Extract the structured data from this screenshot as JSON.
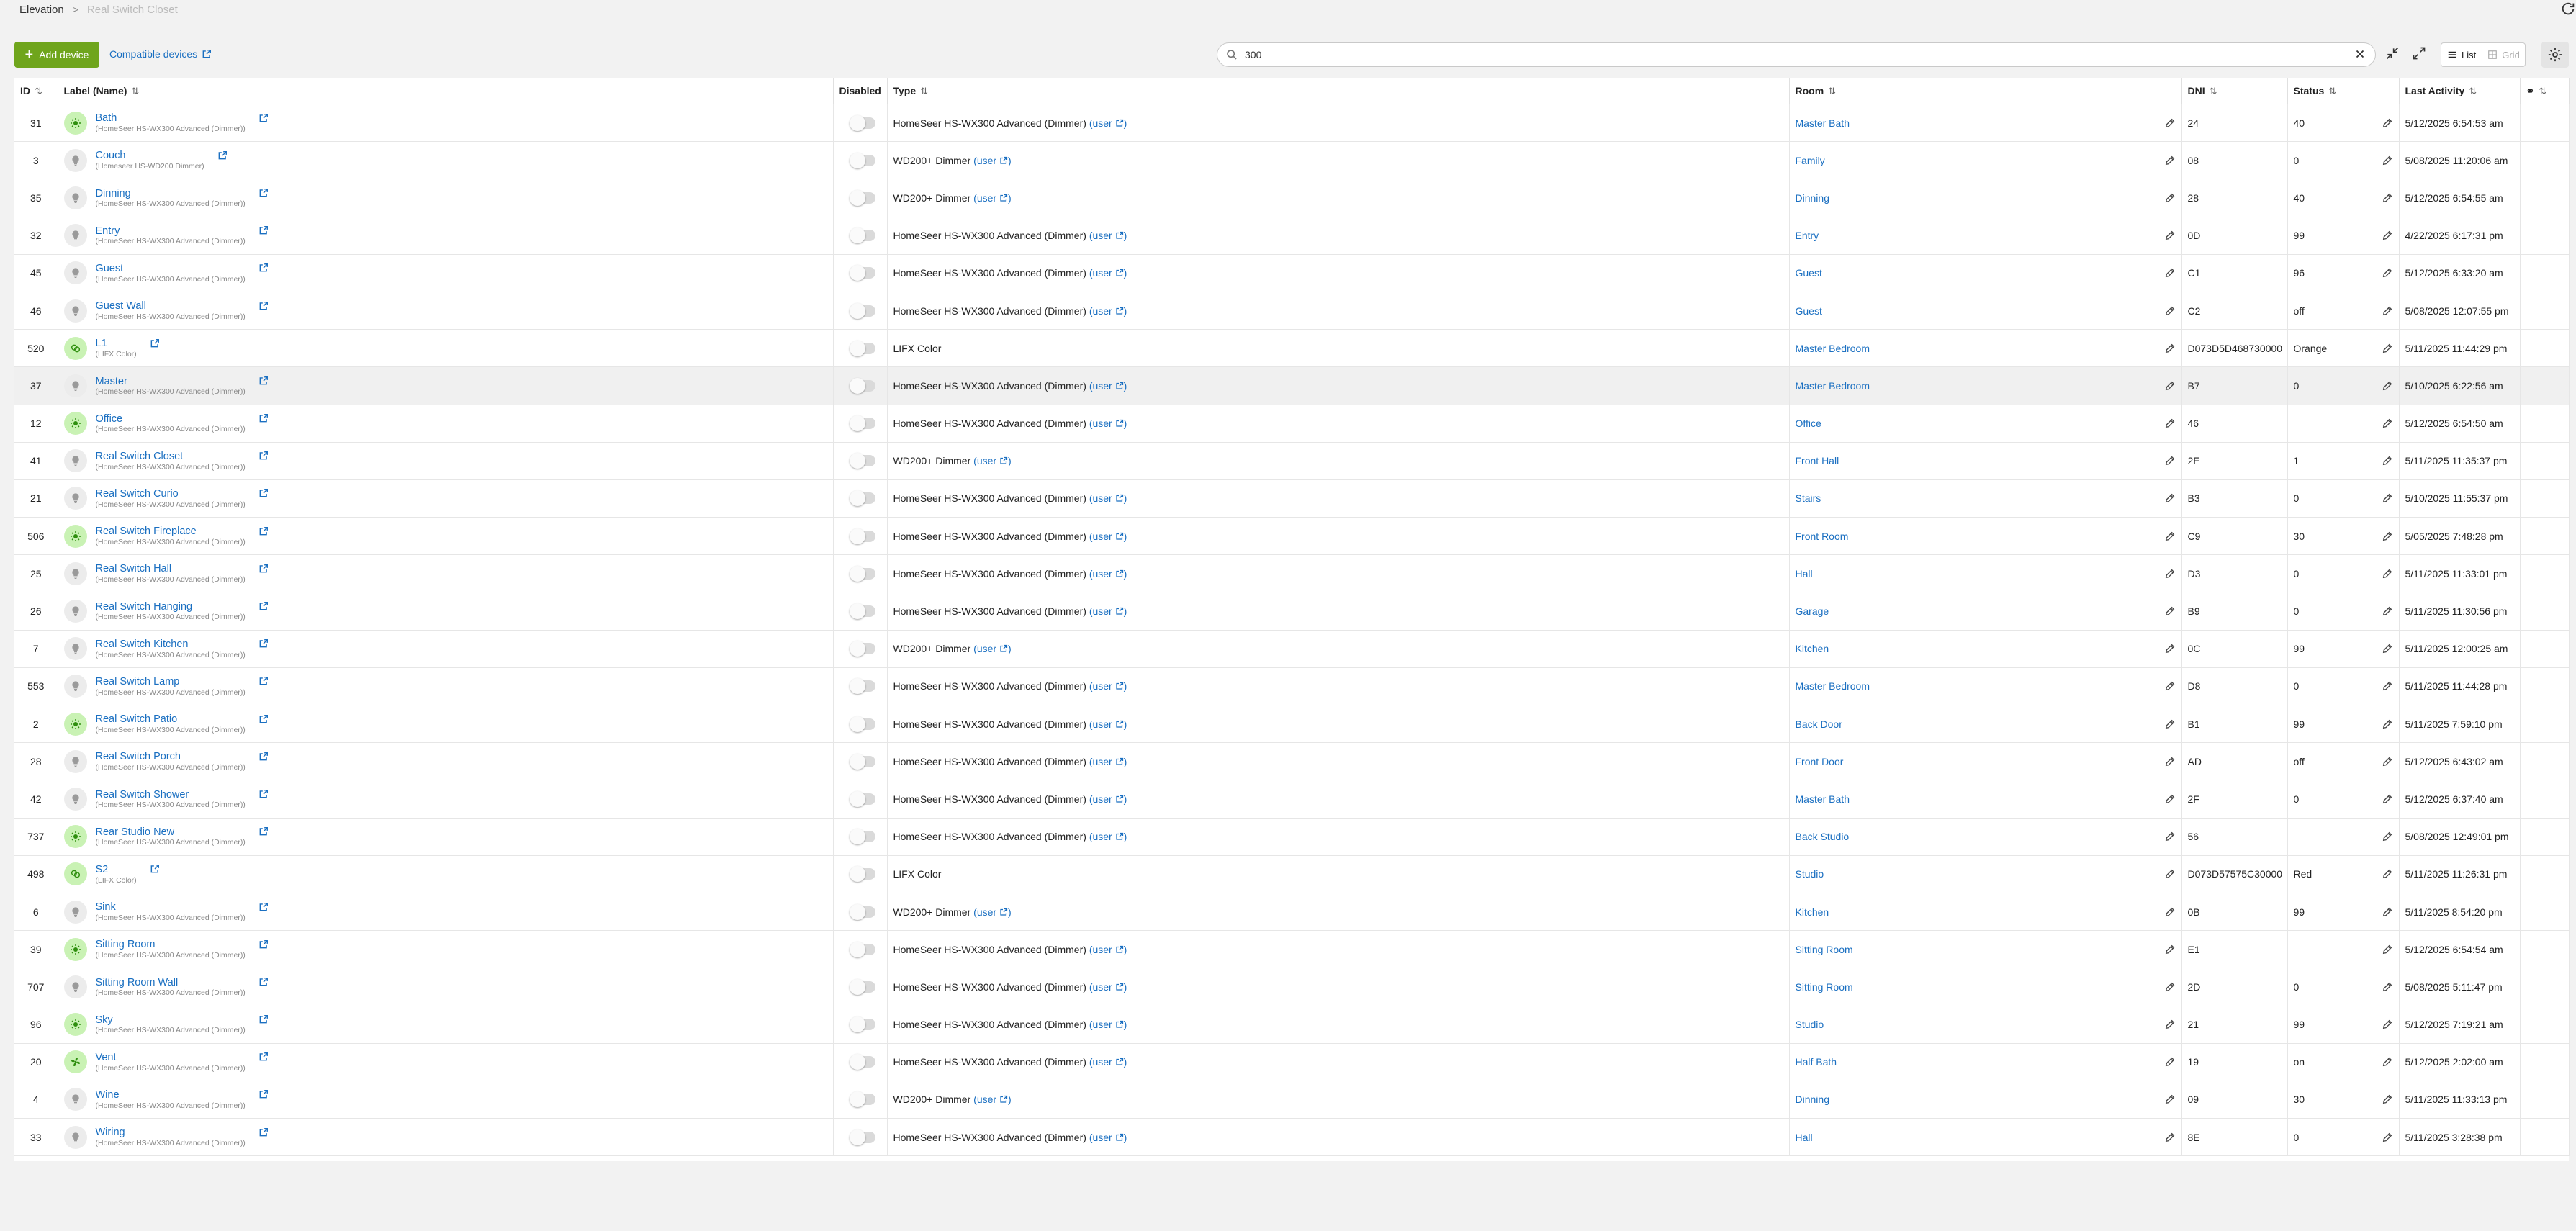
{
  "breadcrumb": {
    "root": "Elevation",
    "current": "Real Switch Closet"
  },
  "toolbar": {
    "add_label": "Add device",
    "compatible_label": "Compatible devices",
    "search_value": "300",
    "view_list": "List",
    "view_grid": "Grid"
  },
  "columns": {
    "id": "ID",
    "label": "Label (Name)",
    "disabled": "Disabled",
    "type": "Type",
    "room": "Room",
    "dni": "DNI",
    "status": "Status",
    "last_activity": "Last Activity"
  },
  "user_text": "user",
  "colors": {
    "accent": "#6fa51c",
    "link": "#1a6fc1",
    "bulb_on_bg": "#c9f2b4",
    "bulb_on_fg": "#2f8f0f"
  },
  "rows": [
    {
      "id": "31",
      "label": "Bath",
      "name": "(HomeSeer HS-WX300 Advanced (Dimmer))",
      "on": true,
      "icon": "sun-icon",
      "type": "HomeSeer HS-WX300 Advanced (Dimmer)",
      "room": "Master Bath",
      "dni": "24",
      "status": "40",
      "last": "5/12/2025 6:54:53 am"
    },
    {
      "id": "3",
      "label": "Couch",
      "name": "(Homeseer HS-WD200 Dimmer)",
      "on": false,
      "icon": "bulb-icon",
      "type": "WD200+ Dimmer",
      "room": "Family",
      "dni": "08",
      "status": "0",
      "last": "5/08/2025 11:20:06 am"
    },
    {
      "id": "35",
      "label": "Dinning",
      "name": "(HomeSeer HS-WX300 Advanced (Dimmer))",
      "on": false,
      "icon": "bulb-icon",
      "type": "WD200+ Dimmer",
      "room": "Dinning",
      "dni": "28",
      "status": "40",
      "last": "5/12/2025 6:54:55 am"
    },
    {
      "id": "32",
      "label": "Entry",
      "name": "(HomeSeer HS-WX300 Advanced (Dimmer))",
      "on": false,
      "icon": "bulb-icon",
      "type": "HomeSeer HS-WX300 Advanced (Dimmer)",
      "room": "Entry",
      "dni": "0D",
      "status": "99",
      "last": "4/22/2025 6:17:31 pm"
    },
    {
      "id": "45",
      "label": "Guest",
      "name": "(HomeSeer HS-WX300 Advanced (Dimmer))",
      "on": false,
      "icon": "bulb-icon",
      "type": "HomeSeer HS-WX300 Advanced (Dimmer)",
      "room": "Guest",
      "dni": "C1",
      "status": "96",
      "last": "5/12/2025 6:33:20 am"
    },
    {
      "id": "46",
      "label": "Guest Wall",
      "name": "(HomeSeer HS-WX300 Advanced (Dimmer))",
      "on": false,
      "icon": "bulb-icon",
      "type": "HomeSeer HS-WX300 Advanced (Dimmer)",
      "room": "Guest",
      "dni": "C2",
      "status": "off",
      "last": "5/08/2025 12:07:55 pm"
    },
    {
      "id": "520",
      "label": "L1",
      "name": "(LIFX Color)",
      "on": true,
      "icon": "color-bulb-icon",
      "type": "LIFX Color",
      "room": "Master Bedroom",
      "dni": "D073D5D468730000",
      "status": "Orange",
      "last": "5/11/2025 11:44:29 pm"
    },
    {
      "id": "37",
      "label": "Master",
      "name": "(HomeSeer HS-WX300 Advanced (Dimmer))",
      "on": false,
      "icon": "bulb-icon",
      "type": "HomeSeer HS-WX300 Advanced (Dimmer)",
      "room": "Master Bedroom",
      "dni": "B7",
      "status": "0",
      "last": "5/10/2025 6:22:56 am",
      "highlight": true
    },
    {
      "id": "12",
      "label": "Office",
      "name": "(HomeSeer HS-WX300 Advanced (Dimmer))",
      "on": true,
      "icon": "sun-icon",
      "type": "HomeSeer HS-WX300 Advanced (Dimmer)",
      "room": "Office",
      "dni": "46",
      "status": "",
      "last": "5/12/2025 6:54:50 am"
    },
    {
      "id": "41",
      "label": "Real Switch Closet",
      "name": "(HomeSeer HS-WX300 Advanced (Dimmer))",
      "on": false,
      "icon": "bulb-icon",
      "type": "WD200+ Dimmer",
      "room": "Front Hall",
      "dni": "2E",
      "status": "1",
      "last": "5/11/2025 11:35:37 pm"
    },
    {
      "id": "21",
      "label": "Real Switch Curio",
      "name": "(HomeSeer HS-WX300 Advanced (Dimmer))",
      "on": false,
      "icon": "bulb-icon",
      "type": "HomeSeer HS-WX300 Advanced (Dimmer)",
      "room": "Stairs",
      "dni": "B3",
      "status": "0",
      "last": "5/10/2025 11:55:37 pm"
    },
    {
      "id": "506",
      "label": "Real Switch Fireplace",
      "name": "(HomeSeer HS-WX300 Advanced (Dimmer))",
      "on": true,
      "icon": "sun-icon",
      "type": "HomeSeer HS-WX300 Advanced (Dimmer)",
      "room": "Front Room",
      "dni": "C9",
      "status": "30",
      "last": "5/05/2025 7:48:28 pm"
    },
    {
      "id": "25",
      "label": "Real Switch Hall",
      "name": "(HomeSeer HS-WX300 Advanced (Dimmer))",
      "on": false,
      "icon": "bulb-icon",
      "type": "HomeSeer HS-WX300 Advanced (Dimmer)",
      "room": "Hall",
      "dni": "D3",
      "status": "0",
      "last": "5/11/2025 11:33:01 pm"
    },
    {
      "id": "26",
      "label": "Real Switch Hanging",
      "name": "(HomeSeer HS-WX300 Advanced (Dimmer))",
      "on": false,
      "icon": "bulb-icon",
      "type": "HomeSeer HS-WX300 Advanced (Dimmer)",
      "room": "Garage",
      "dni": "B9",
      "status": "0",
      "last": "5/11/2025 11:30:56 pm"
    },
    {
      "id": "7",
      "label": "Real Switch Kitchen",
      "name": "(HomeSeer HS-WX300 Advanced (Dimmer))",
      "on": false,
      "icon": "bulb-icon",
      "type": "WD200+ Dimmer",
      "room": "Kitchen",
      "dni": "0C",
      "status": "99",
      "last": "5/11/2025 12:00:25 am"
    },
    {
      "id": "553",
      "label": "Real Switch Lamp",
      "name": "(HomeSeer HS-WX300 Advanced (Dimmer))",
      "on": false,
      "icon": "bulb-icon",
      "type": "HomeSeer HS-WX300 Advanced (Dimmer)",
      "room": "Master Bedroom",
      "dni": "D8",
      "status": "0",
      "last": "5/11/2025 11:44:28 pm"
    },
    {
      "id": "2",
      "label": "Real Switch Patio",
      "name": "(HomeSeer HS-WX300 Advanced (Dimmer))",
      "on": true,
      "icon": "sun-icon",
      "type": "HomeSeer HS-WX300 Advanced (Dimmer)",
      "room": "Back Door",
      "dni": "B1",
      "status": "99",
      "last": "5/11/2025 7:59:10 pm"
    },
    {
      "id": "28",
      "label": "Real Switch Porch",
      "name": "(HomeSeer HS-WX300 Advanced (Dimmer))",
      "on": false,
      "icon": "bulb-icon",
      "type": "HomeSeer HS-WX300 Advanced (Dimmer)",
      "room": "Front Door",
      "dni": "AD",
      "status": "off",
      "last": "5/12/2025 6:43:02 am"
    },
    {
      "id": "42",
      "label": "Real Switch Shower",
      "name": "(HomeSeer HS-WX300 Advanced (Dimmer))",
      "on": false,
      "icon": "bulb-icon",
      "type": "HomeSeer HS-WX300 Advanced (Dimmer)",
      "room": "Master Bath",
      "dni": "2F",
      "status": "0",
      "last": "5/12/2025 6:37:40 am"
    },
    {
      "id": "737",
      "label": "Rear Studio New",
      "name": "(HomeSeer HS-WX300 Advanced (Dimmer))",
      "on": true,
      "icon": "sun-icon",
      "type": "HomeSeer HS-WX300 Advanced (Dimmer)",
      "room": "Back Studio",
      "dni": "56",
      "status": "",
      "last": "5/08/2025 12:49:01 pm"
    },
    {
      "id": "498",
      "label": "S2",
      "name": "(LIFX Color)",
      "on": true,
      "icon": "color-bulb-icon",
      "type": "LIFX Color",
      "room": "Studio",
      "dni": "D073D57575C30000",
      "status": "Red",
      "last": "5/11/2025 11:26:31 pm"
    },
    {
      "id": "6",
      "label": "Sink",
      "name": "(HomeSeer HS-WX300 Advanced (Dimmer))",
      "on": false,
      "icon": "bulb-icon",
      "type": "WD200+ Dimmer",
      "room": "Kitchen",
      "dni": "0B",
      "status": "99",
      "last": "5/11/2025 8:54:20 pm"
    },
    {
      "id": "39",
      "label": "Sitting Room",
      "name": "(HomeSeer HS-WX300 Advanced (Dimmer))",
      "on": true,
      "icon": "sun-icon",
      "type": "HomeSeer HS-WX300 Advanced (Dimmer)",
      "room": "Sitting Room",
      "dni": "E1",
      "status": "",
      "last": "5/12/2025 6:54:54 am"
    },
    {
      "id": "707",
      "label": "Sitting Room Wall",
      "name": "(HomeSeer HS-WX300 Advanced (Dimmer))",
      "on": false,
      "icon": "bulb-icon",
      "type": "HomeSeer HS-WX300 Advanced (Dimmer)",
      "room": "Sitting Room",
      "dni": "2D",
      "status": "0",
      "last": "5/08/2025 5:11:47 pm"
    },
    {
      "id": "96",
      "label": "Sky",
      "name": "(HomeSeer HS-WX300 Advanced (Dimmer))",
      "on": true,
      "icon": "sun-icon",
      "type": "HomeSeer HS-WX300 Advanced (Dimmer)",
      "room": "Studio",
      "dni": "21",
      "status": "99",
      "last": "5/12/2025 7:19:21 am"
    },
    {
      "id": "20",
      "label": "Vent",
      "name": "(HomeSeer HS-WX300 Advanced (Dimmer))",
      "on": true,
      "icon": "fan-icon",
      "type": "HomeSeer HS-WX300 Advanced (Dimmer)",
      "room": "Half Bath",
      "dni": "19",
      "status": "on",
      "last": "5/12/2025 2:02:00 am"
    },
    {
      "id": "4",
      "label": "Wine",
      "name": "(HomeSeer HS-WX300 Advanced (Dimmer))",
      "on": false,
      "icon": "bulb-icon",
      "type": "WD200+ Dimmer",
      "room": "Dinning",
      "dni": "09",
      "status": "30",
      "last": "5/11/2025 11:33:13 pm"
    },
    {
      "id": "33",
      "label": "Wiring",
      "name": "(HomeSeer HS-WX300 Advanced (Dimmer))",
      "on": false,
      "icon": "bulb-icon",
      "type": "HomeSeer HS-WX300 Advanced (Dimmer)",
      "room": "Hall",
      "dni": "8E",
      "status": "0",
      "last": "5/11/2025 3:28:38 pm"
    }
  ]
}
